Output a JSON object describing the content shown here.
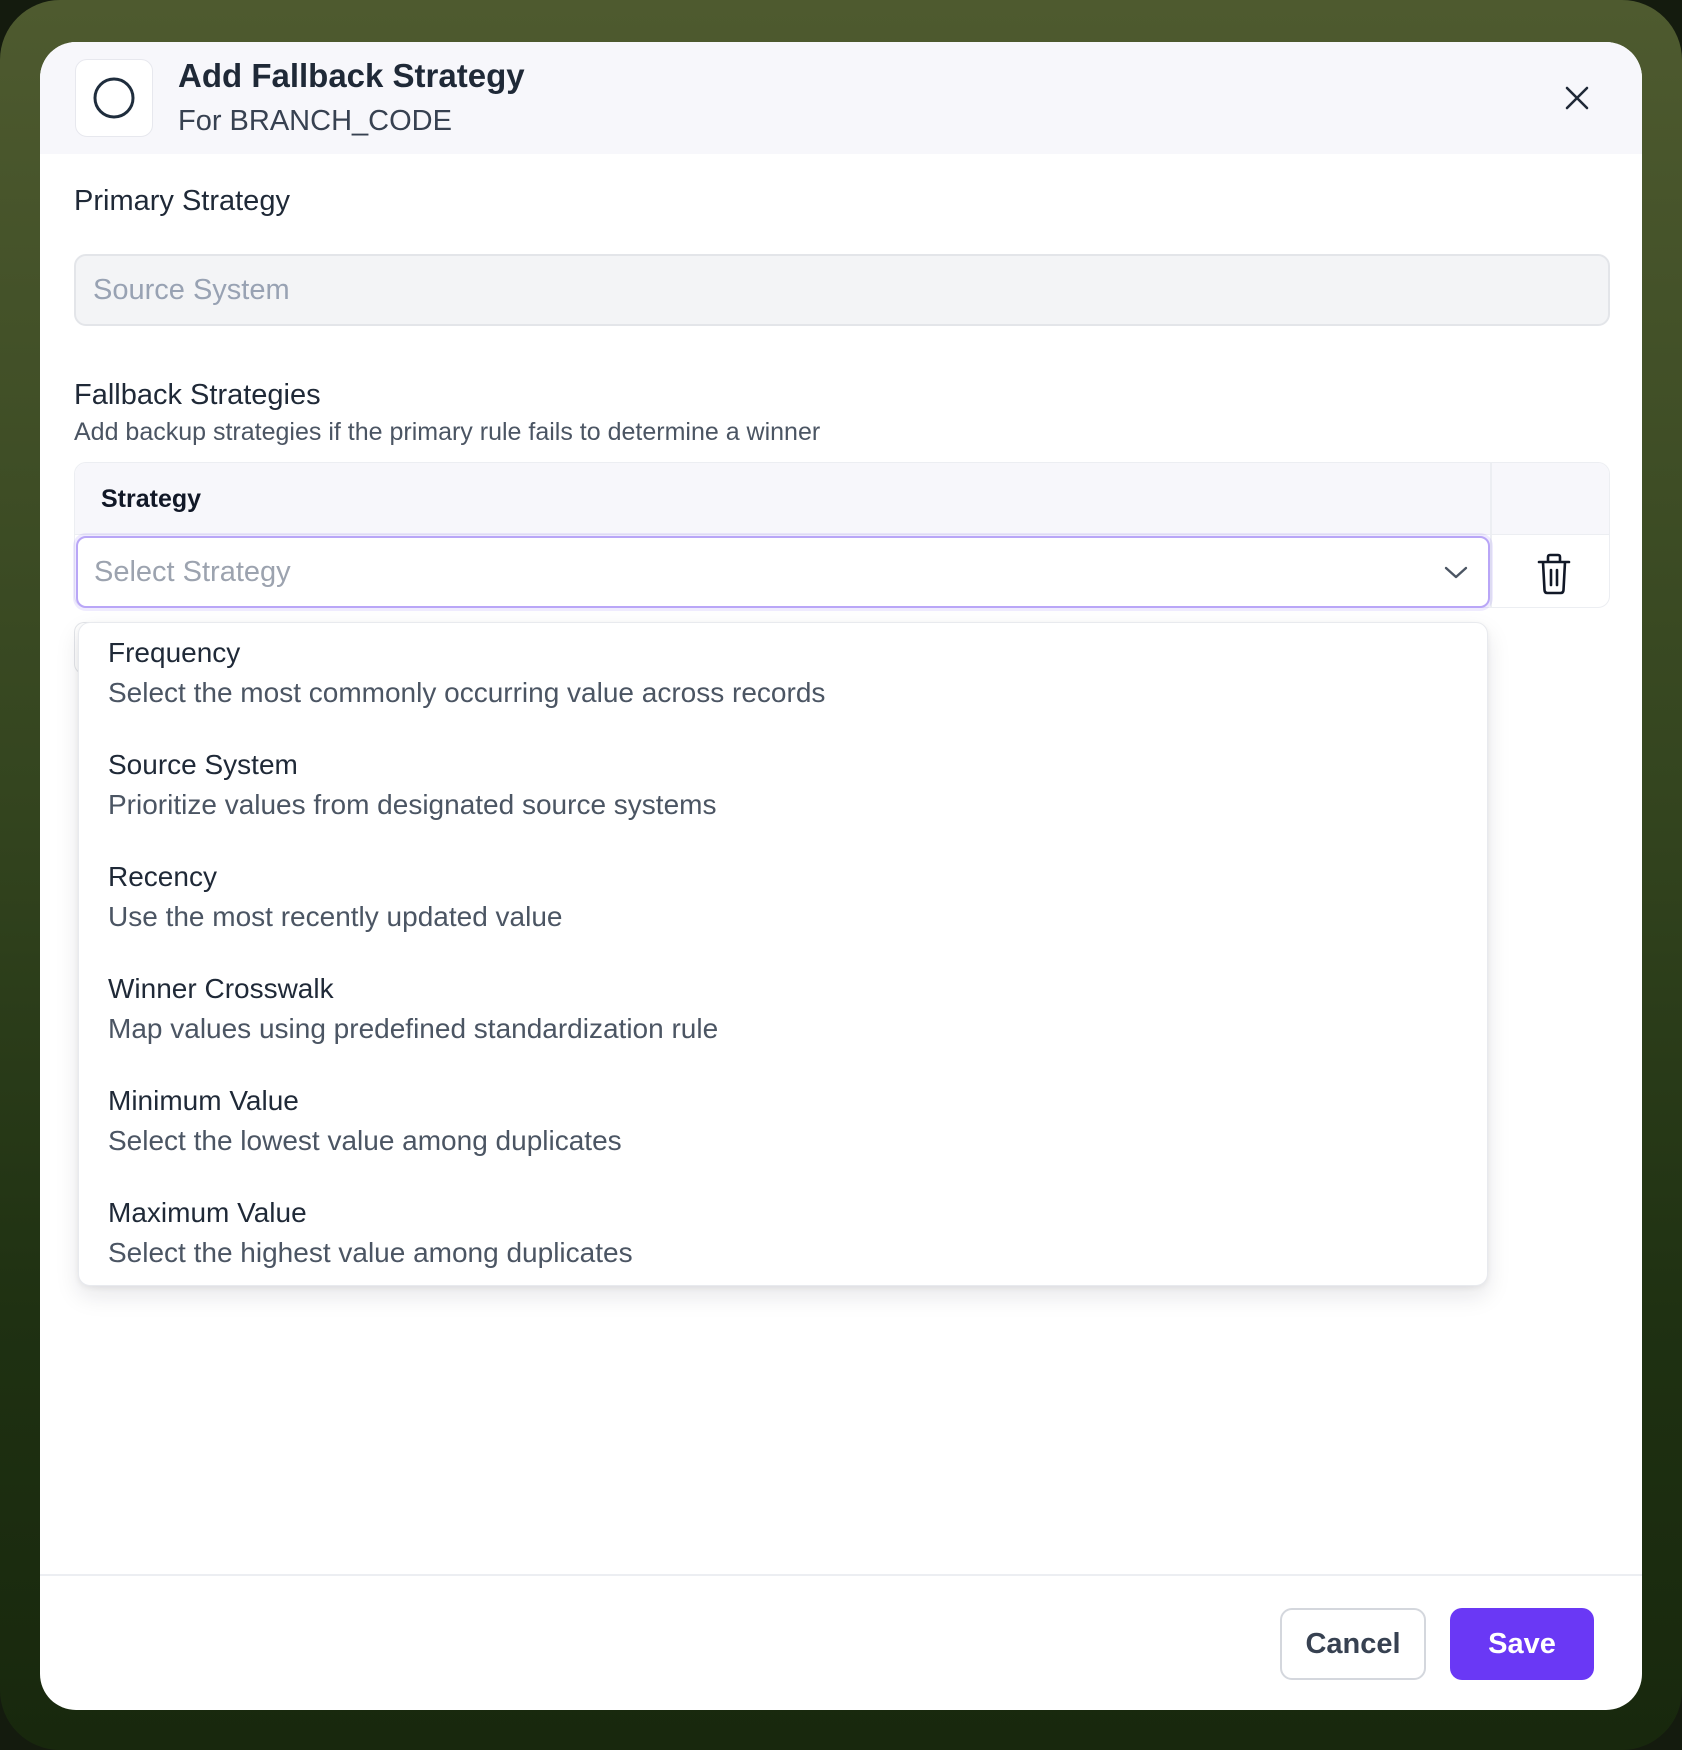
{
  "dialog": {
    "title": "Add Fallback Strategy",
    "subtitle": "For BRANCH_CODE",
    "header_icon": "circle-icon",
    "close_icon": "close-icon"
  },
  "primary": {
    "label": "Primary Strategy",
    "value": "Source System"
  },
  "fallback": {
    "label": "Fallback Strategies",
    "helper": "Add backup strategies if the primary rule fails to determine a winner",
    "table": {
      "column_header": "Strategy",
      "row": {
        "placeholder": "Select Strategy",
        "chevron_icon": "chevron-down-icon",
        "delete_icon": "trash-icon"
      }
    }
  },
  "dropdown": {
    "options": [
      {
        "title": "Frequency",
        "description": "Select the most commonly occurring value across records"
      },
      {
        "title": "Source System",
        "description": "Prioritize values from designated source systems"
      },
      {
        "title": "Recency",
        "description": "Use the most recently updated value"
      },
      {
        "title": "Winner Crosswalk",
        "description": "Map values using predefined standardization rule"
      },
      {
        "title": "Minimum Value",
        "description": "Select the lowest value among duplicates"
      },
      {
        "title": "Maximum Value",
        "description": "Select the highest value among duplicates"
      }
    ]
  },
  "footer": {
    "cancel_label": "Cancel",
    "save_label": "Save"
  },
  "colors": {
    "accent": "#6a38f5",
    "focus_border": "#b9a6f7",
    "text_primary": "#1f2937",
    "text_muted": "#9ca3af"
  }
}
